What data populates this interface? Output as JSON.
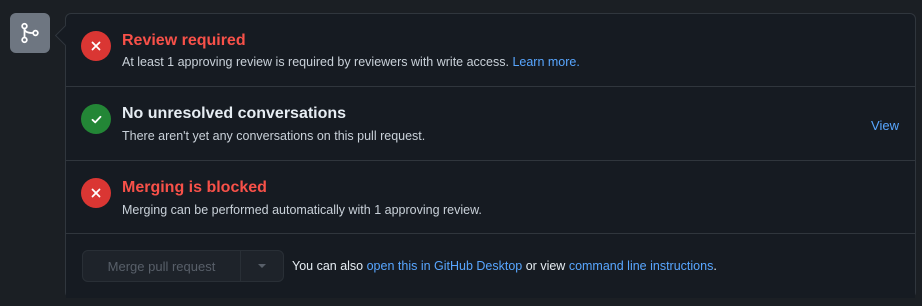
{
  "checks": [
    {
      "status": "fail",
      "title": "Review required",
      "description": "At least 1 approving review is required by reviewers with write access.",
      "link": "Learn more."
    },
    {
      "status": "pass",
      "title": "No unresolved conversations",
      "description": "There aren't yet any conversations on this pull request.",
      "action": "View"
    },
    {
      "status": "fail",
      "title": "Merging is blocked",
      "description": "Merging can be performed automatically with 1 approving review."
    }
  ],
  "merge": {
    "button_label": "Merge pull request",
    "button_disabled": true,
    "alt_prefix": "You can also",
    "desktop_link": "open this in GitHub Desktop",
    "alt_middle": "or view",
    "cli_link": "command line instructions",
    "alt_suffix": "."
  },
  "icons": {
    "side": "git-merge-icon",
    "fail": "x-icon",
    "pass": "check-icon",
    "caret": "triangle-down-icon"
  },
  "colors": {
    "fail": "#da3633",
    "fail_text": "#f85149",
    "pass": "#238636",
    "link": "#58a6ff",
    "background": "#161b22",
    "border": "#30363d"
  }
}
